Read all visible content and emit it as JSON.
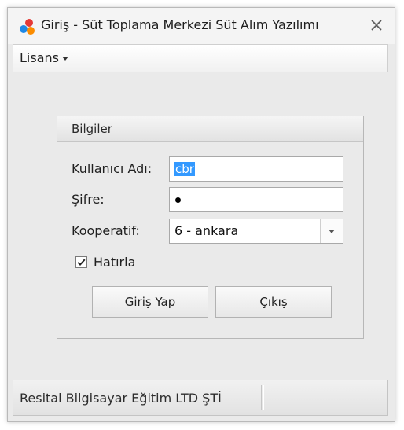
{
  "window": {
    "title": "Giriş - Süt Toplama Merkezi Süt Alım Yazılımı",
    "close_icon": "close-icon",
    "app_icon": "colored-dots-icon"
  },
  "menu": {
    "items": [
      {
        "label": "Lisans",
        "icon": "chevron-down-icon"
      }
    ]
  },
  "group": {
    "title": "Bilgiler"
  },
  "form": {
    "username_label": "Kullanıcı Adı:",
    "username_value": "cbr",
    "password_label": "Şifre:",
    "password_length": 1,
    "cooperative_label": "Kooperatif:",
    "cooperative_value": "6 - ankara",
    "remember_label": "Hatırla",
    "remember_checked": true
  },
  "buttons": {
    "login_label": "Giriş Yap",
    "exit_label": "Çıkış"
  },
  "status": {
    "text": "Resital Bilgisayar Eğitim LTD ŞTİ"
  },
  "colors": {
    "selection": "#3399ff",
    "window_bg": "#eaeaea"
  }
}
